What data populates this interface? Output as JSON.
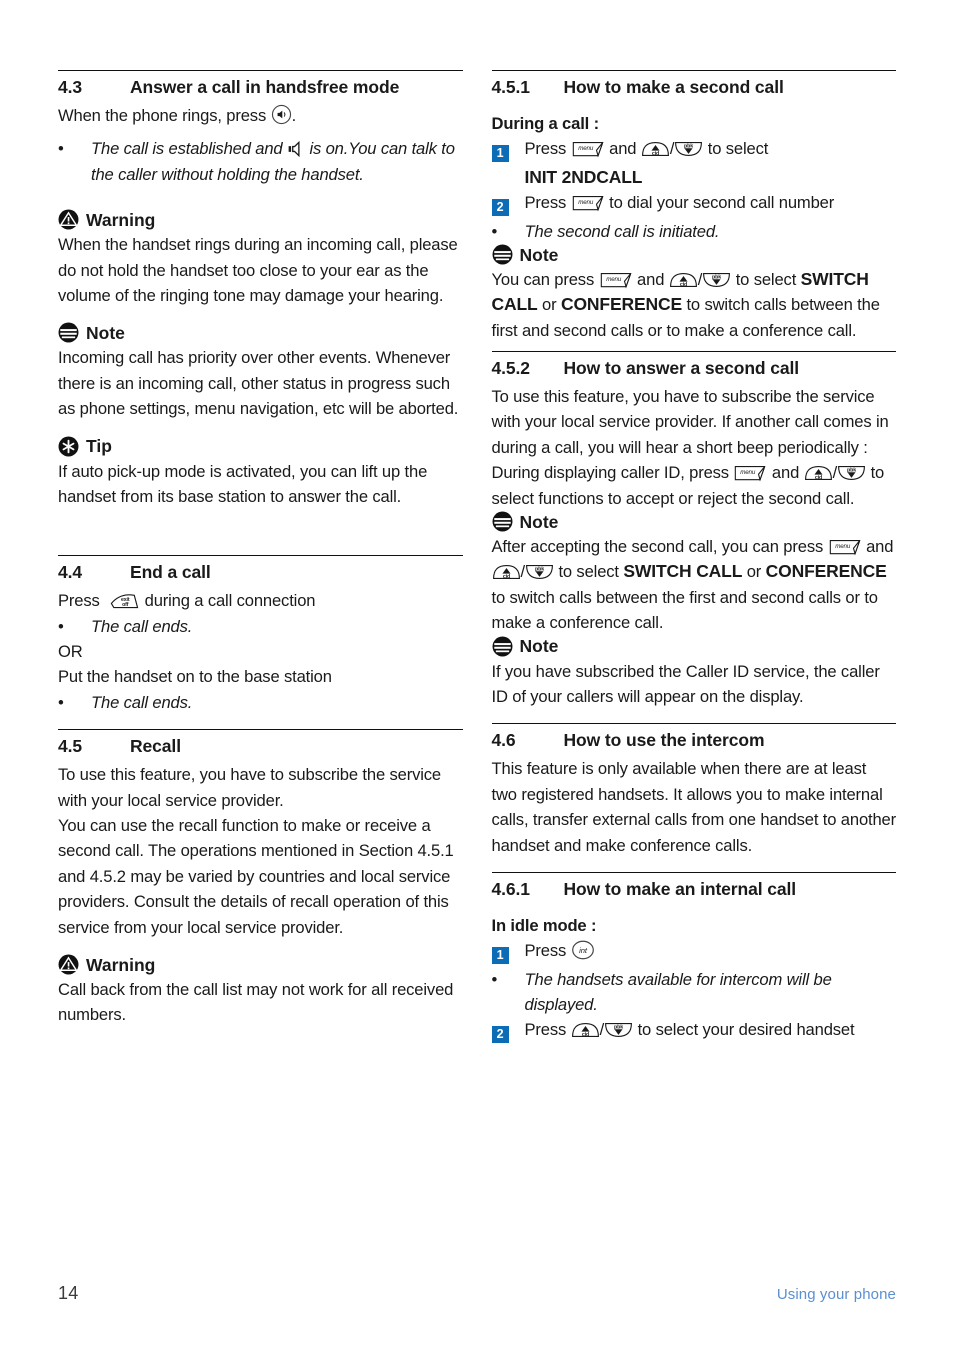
{
  "page": {
    "number": "14",
    "footer_label": "Using your phone",
    "accent_blue": "#0c6cb5",
    "footer_blue": "#5b8fd0"
  },
  "left_column": {
    "section_43": {
      "number": "4.3",
      "title": "Answer a call in handsfree mode",
      "intro_before_icon": "When the phone rings, press",
      "intro_after_icon": ".",
      "bullet_part1": "The call is established and",
      "bullet_part2": "is on.You can talk to the caller without holding the handset."
    },
    "warning_1": {
      "label": "Warning",
      "text": "When the handset rings during an incoming call, please do not hold the handset too close to your ear as the volume of the ringing tone may damage your hearing."
    },
    "note_1": {
      "label": "Note",
      "text": "Incoming call has priority over other events. Whenever there is an incoming call, other status in progress such as phone settings, menu navigation, etc will be aborted."
    },
    "tip_1": {
      "label": "Tip",
      "text": "If auto pick-up mode is activated, you can lift up the handset from its base station to answer the call."
    },
    "section_44": {
      "number": "4.4",
      "title": "End a call",
      "press_before_icon": "Press",
      "press_after_icon": "during a call connection",
      "bullet_1": "The call ends.",
      "or_text": "OR",
      "alt_line": "Put the handset on to the base station",
      "bullet_2": "The call ends."
    },
    "section_45": {
      "number": "4.5",
      "title": "Recall",
      "para_1": "To use this feature, you have to subscribe the service with your local service provider.",
      "para_2": "You can use the recall function to make or receive a second call. The operations mentioned in Section 4.5.1 and 4.5.2 may be varied by countries and local service providers. Consult the details of recall operation of this service from your local service provider."
    },
    "warning_2": {
      "label": "Warning",
      "text": "Call back from the call list may not work for all received numbers."
    }
  },
  "right_column": {
    "section_451": {
      "number": "4.5.1",
      "title": "How to make a second call",
      "subhead": "During a call :",
      "step1_num": "1",
      "step1_before": "Press",
      "step1_mid": "and",
      "step1_after": "to select",
      "step1_result": "INIT 2NDCALL",
      "step2_num": "2",
      "step2_before": "Press",
      "step2_after": "to dial your second call number",
      "bullet": "The second call is initiated."
    },
    "note_451": {
      "label": "Note",
      "before_icon": "You can press",
      "mid": "and",
      "after_icons": "to select",
      "bold_1": "SWITCH CALL",
      "between": "or",
      "bold_2": "CONFERENCE",
      "tail": "to switch calls between the first and second calls or to make a conference call."
    },
    "section_452": {
      "number": "4.5.2",
      "title": "How to answer a second call",
      "para_1": "To use this feature, you have to subscribe the service with your local service provider. If another call comes in during a call, you will hear a short beep periodically :",
      "para_2_before": "During displaying caller ID, press",
      "para_2_and": "and",
      "para_2_after": "to select functions to accept or reject the second call."
    },
    "note_452a": {
      "label": "Note",
      "lead": "After accepting the second call, you can press",
      "mid": "and",
      "after_icons": "to select",
      "bold_1": "SWITCH CALL",
      "between": "or",
      "bold_2": "CONFERENCE",
      "tail": "to switch calls between the first and second calls or to make a conference call."
    },
    "note_452b": {
      "label": "Note",
      "text": "If you have subscribed the Caller ID service, the caller ID of your callers will appear on the display."
    },
    "section_46": {
      "number": "4.6",
      "title": "How to use the intercom",
      "para": "This feature is only available when there are at least two registered handsets. It allows you to make internal calls, transfer external calls from one handset to another handset and make conference calls."
    },
    "section_461": {
      "number": "4.6.1",
      "title": "How to make an internal call",
      "subhead": "In idle mode :",
      "step1_num": "1",
      "step1_before": "Press",
      "bullet": "The handsets available for intercom will be displayed.",
      "step2_num": "2",
      "step2_before": "Press",
      "step2_after": "to select your desired handset"
    }
  },
  "icons": {
    "handsfree": "speaker-key-icon",
    "speaker": "speaker-on-icon",
    "menu_key": "menu-key-icon",
    "up_cid_key": "up-cid-key-icon",
    "down_pbk_key": "down-pbk-key-icon",
    "exit_off_key": "exit-off-key-icon",
    "int_key": "int-key-icon",
    "warning": "warning-triangle-icon",
    "note": "note-circle-icon",
    "tip": "tip-asterisk-icon"
  }
}
